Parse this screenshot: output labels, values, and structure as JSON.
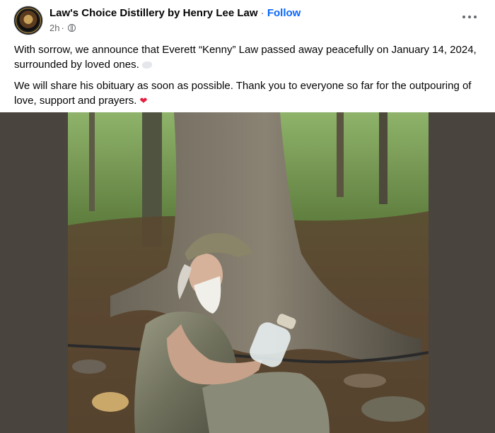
{
  "post": {
    "page_name": "Law's Choice Distillery by Henry Lee Law",
    "separator": "·",
    "follow_label": "Follow",
    "time": "2h",
    "time_sep": "·",
    "paragraph1": "With sorrow, we announce that Everett “Kenny” Law passed away peacefully on January 14, 2024, surrounded by loved ones.",
    "paragraph2": "We will share his obituary as soon as possible. Thank you to everyone so far for the outpouring of love, support and prayers.",
    "icons": {
      "avatar": "page-avatar",
      "privacy": "globe-icon",
      "menu": "more-options-icon",
      "emoji1": "dove-icon",
      "emoji2": "heart-icon"
    },
    "photo": {
      "subject": "man with white beard in camouflage holding a glass jar beside a large tree trunk in a forest"
    }
  },
  "colors": {
    "link": "#0866ff",
    "secondary_text": "#65676b",
    "media_background": "#4a443e"
  }
}
